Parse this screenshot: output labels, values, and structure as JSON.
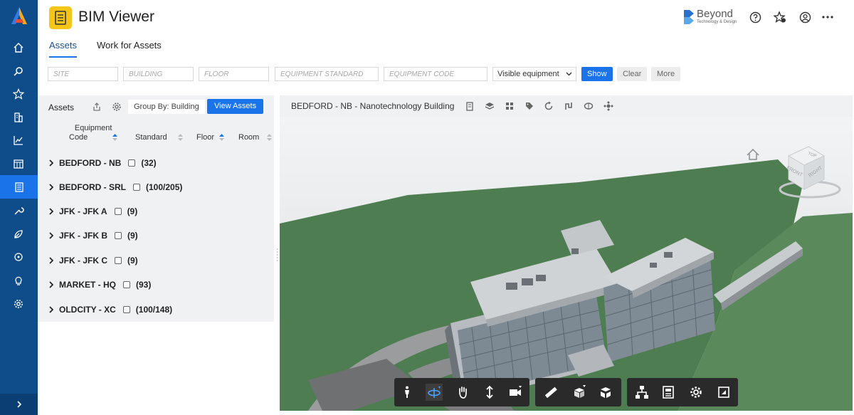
{
  "app": {
    "title": "BIM Viewer",
    "brand": {
      "name": "Beyond",
      "tagline": "Technology & Design"
    }
  },
  "tabs": [
    {
      "label": "Assets",
      "active": true
    },
    {
      "label": "Work for Assets",
      "active": false
    }
  ],
  "filters": {
    "site_placeholder": "SITE",
    "building_placeholder": "BUILDING",
    "floor_placeholder": "FLOOR",
    "equipment_standard_placeholder": "EQUIPMENT STANDARD",
    "equipment_code_placeholder": "EQUIPMENT CODE",
    "visibility_selected": "Visible equipment",
    "show_label": "Show",
    "clear_label": "Clear",
    "more_label": "More"
  },
  "assets_panel": {
    "title": "Assets",
    "group_by_label": "Group By: Building",
    "view_assets_label": "View Assets",
    "columns": {
      "equipment_code_line1": "Equipment",
      "equipment_code_line2": "Code",
      "standard": "Standard",
      "floor": "Floor",
      "room": "Room"
    },
    "groups": [
      {
        "name": "BEDFORD - NB",
        "count": "(32)"
      },
      {
        "name": "BEDFORD - SRL",
        "count": "(100/205)"
      },
      {
        "name": "JFK - JFK A",
        "count": "(9)"
      },
      {
        "name": "JFK - JFK B",
        "count": "(9)"
      },
      {
        "name": "JFK - JFK C",
        "count": "(9)"
      },
      {
        "name": "MARKET - HQ",
        "count": "(93)"
      },
      {
        "name": "OLDCITY - XC",
        "count": "(100/148)"
      }
    ]
  },
  "viewer": {
    "title": "BEDFORD - NB - Nanotechnology Building",
    "viewcube": {
      "top": "TOP",
      "front": "FRONT",
      "right": "RIGHT"
    }
  },
  "colors": {
    "rail": "#0f4c8a",
    "accent": "#1a73e8",
    "app_badge": "#f5c518",
    "terrain": "#4f7d52"
  }
}
